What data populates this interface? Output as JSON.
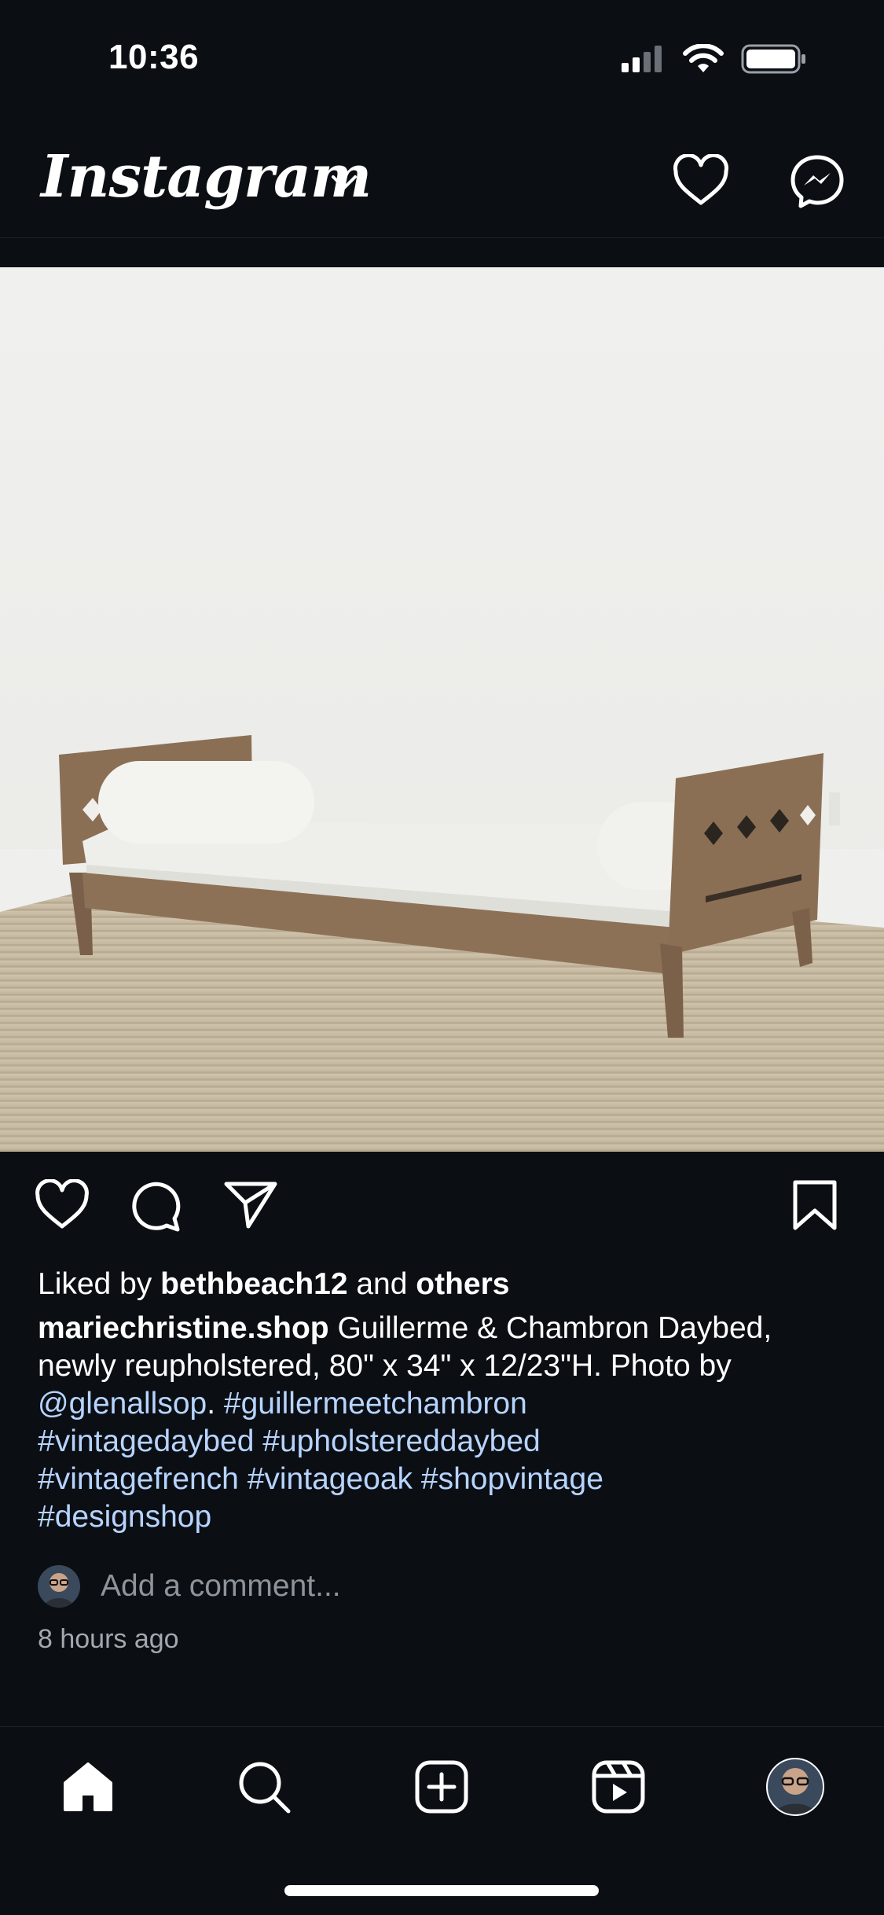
{
  "status_bar": {
    "time": "10:36",
    "icons": [
      "cellular-signal-icon",
      "wifi-icon",
      "battery-icon"
    ]
  },
  "header": {
    "brand": "Instagram",
    "icons": [
      "chevron-down-icon",
      "heart-icon",
      "messenger-icon"
    ]
  },
  "post": {
    "image_alt": "Wooden daybed with white upholstered cushion and two bolster pillows on a woven rug",
    "actions": [
      "like-icon",
      "comment-icon",
      "share-icon",
      "bookmark-icon"
    ],
    "likes": {
      "prefix": "Liked by ",
      "user": "bethbeach12",
      "middle": " and ",
      "others": "others"
    },
    "caption": {
      "username": "mariechristine.shop",
      "text_line1": " Guillerme & Chambron Daybed,",
      "text_line2": "newly reupholstered, 80\" x 34\" x 12/23\"H.  Photo by",
      "mention": "@glenallsop",
      "after_mention": ".  ",
      "hashtags": [
        "#guillermeetchambron",
        "#vintagedaybed",
        "#upholstereddaybed",
        "#vintagefrench",
        "#vintageoak",
        "#shopvintage",
        "#designshop"
      ]
    },
    "comment_placeholder": "Add a comment...",
    "timestamp": "8 hours ago"
  },
  "tab_bar": {
    "items": [
      "home-icon",
      "search-icon",
      "create-icon",
      "reels-icon",
      "profile-avatar"
    ]
  },
  "colors": {
    "background": "#0b0f14",
    "link": "#b7d4ff",
    "muted": "#8e949b"
  }
}
